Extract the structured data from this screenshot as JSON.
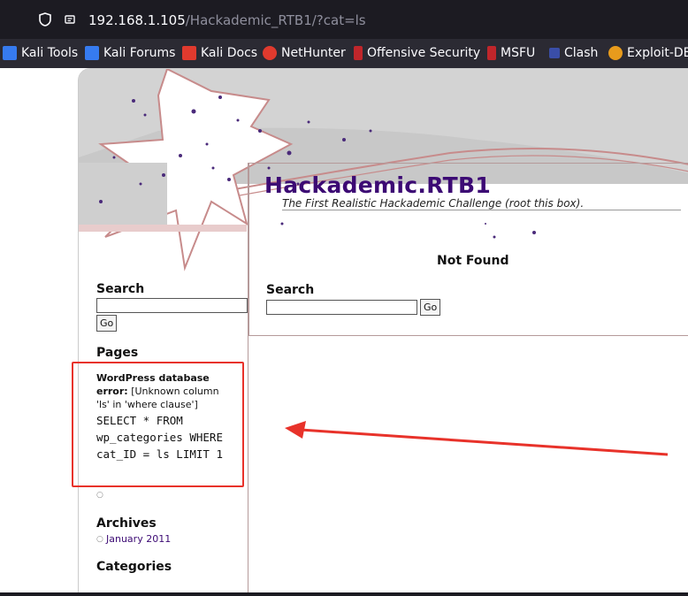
{
  "browser": {
    "url_host": "192.168.1.105",
    "url_path": "/Hackademic_RTB1/?cat=ls"
  },
  "bookmarks": [
    {
      "label": "Kali Tools",
      "icon": "kali-dragon-icon",
      "color": "#367bf0"
    },
    {
      "label": "Kali Forums",
      "icon": "kali-dragon-icon",
      "color": "#367bf0"
    },
    {
      "label": "Kali Docs",
      "icon": "docs-icon",
      "color": "#e03a2e"
    },
    {
      "label": "NetHunter",
      "icon": "nethunter-icon",
      "color": "#e03a2e"
    },
    {
      "label": "Offensive Security",
      "icon": "offsec-icon",
      "color": "#c0262b"
    },
    {
      "label": "MSFU",
      "icon": "msfu-icon",
      "color": "#c0262b"
    },
    {
      "label": "Clash",
      "icon": "clash-icon",
      "color": "#3a4ea8"
    },
    {
      "label": "Exploit-DB",
      "icon": "exploit-db-icon",
      "color": "#e89b1c"
    }
  ],
  "site": {
    "title": "Hackademic.RTB1",
    "tagline": "The First Realistic Hackademic Challenge (root this box).",
    "not_found": "Not Found",
    "search_label": "Search",
    "go_label": "Go"
  },
  "sidebar": {
    "search_label": "Search",
    "go_label": "Go",
    "pages_label": "Pages",
    "error_title": "WordPress database error:",
    "error_msg": "[Unknown column 'ls' in 'where clause']",
    "sql": "SELECT * FROM wp_categories WHERE cat_ID = ls LIMIT 1",
    "archives_label": "Archives",
    "archive_item": "January 2011",
    "categories_label": "Categories"
  },
  "annotation_color": "#e8322a"
}
